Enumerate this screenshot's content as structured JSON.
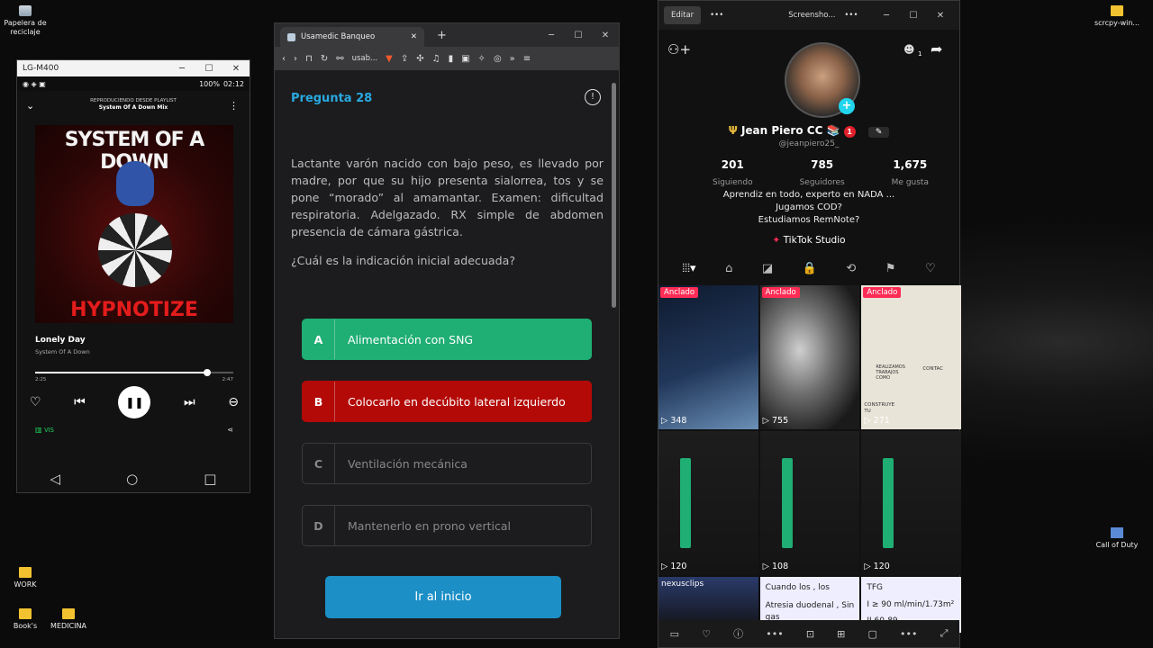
{
  "desktop": {
    "icons": [
      {
        "label": "Papelera de reciclaje"
      },
      {
        "label": "scrcpy-win..."
      },
      {
        "label": "Call of Duty"
      },
      {
        "label": "WORK"
      },
      {
        "label": "Book's"
      },
      {
        "label": "MEDICINA"
      }
    ]
  },
  "phone": {
    "title": "LG-M400",
    "battery": "100%",
    "clock": "02:12",
    "playing_from": "REPRODUCIENDO DESDE PLAYLIST",
    "playlist": "System Of A Down Mix",
    "album_title": "SYSTEM OF A DOWN",
    "album_sub": "HYPNOTIZE",
    "song": "Lonely Day",
    "artist": "System Of A Down",
    "elapsed": "2:25",
    "total": "2:47",
    "progress": 0.87,
    "device": "VIS"
  },
  "browser": {
    "tab_title": "Usamedic Banqueo",
    "url": "usab...",
    "question_label": "Pregunta 28",
    "question": "Lactante varón nacido con bajo peso, es llevado por madre, por que su hijo presenta sialorrea, tos y se pone “morado” al amamantar. Examen: dificultad respiratoria. Adelgazado. RX simple de abdomen presencia de cámara gástrica.",
    "ask": "¿Cuál es la indicación inicial adecuada?",
    "options": [
      {
        "letter": "A",
        "text": "Alimentación con SNG"
      },
      {
        "letter": "B",
        "text": "Colocarlo en decúbito lateral izquierdo"
      },
      {
        "letter": "C",
        "text": "Ventilación mecánica"
      },
      {
        "letter": "D",
        "text": "Mantenerlo en prono vertical"
      }
    ],
    "go_button": "Ir al inicio"
  },
  "tiktok": {
    "edit": "Editar",
    "window_title": "Screensho...",
    "name": "Jean Piero CC",
    "handle": "@jeanpiero25_",
    "badge": "1",
    "notif": "1",
    "following": "201",
    "following_label": "Siguiendo",
    "followers": "785",
    "followers_label": "Seguidores",
    "likes": "1,675",
    "likes_label": "Me gusta",
    "bio1": "Aprendiz en todo, experto en NADA ...",
    "bio2": "Jugamos COD?",
    "bio3": "Estudiamos RemNote?",
    "studio": "TikTok Studio",
    "pinned": "Anclado",
    "videos": [
      {
        "views": "348"
      },
      {
        "views": "755"
      },
      {
        "views": "271"
      },
      {
        "views": "120"
      },
      {
        "views": "108"
      },
      {
        "views": "120"
      }
    ],
    "thumb_text": {
      "c3a": "REALIZAMOS TRABAJOS COMO",
      "c3b": "CONTAC",
      "c3c": "CONSTRUYE TU",
      "r1": "nexusclips",
      "r2a": "Cuando los , los",
      "r2b": "Atresia duodenal , Sin gas",
      "r3a": "TFG",
      "r3b": "I ≥ 90 ml/min/1.73m²",
      "r3c": "II 60-89"
    }
  }
}
